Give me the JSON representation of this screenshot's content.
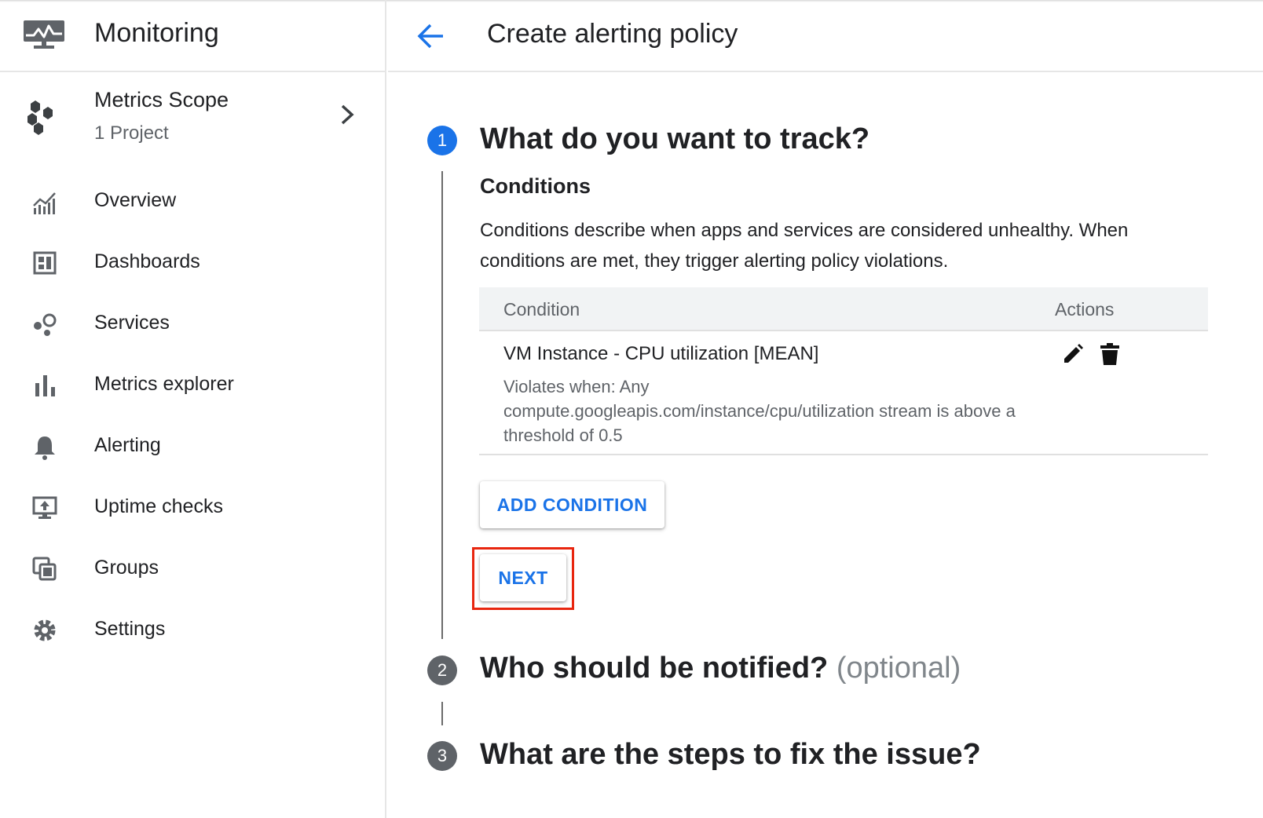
{
  "sidebar": {
    "app_title": "Monitoring",
    "scope": {
      "name": "Metrics Scope",
      "subtitle": "1 Project"
    },
    "items": [
      {
        "label": "Overview",
        "icon": "chart-icon"
      },
      {
        "label": "Dashboards",
        "icon": "dashboard-icon"
      },
      {
        "label": "Services",
        "icon": "services-icon"
      },
      {
        "label": "Metrics explorer",
        "icon": "bar-chart-icon"
      },
      {
        "label": "Alerting",
        "icon": "bell-icon"
      },
      {
        "label": "Uptime checks",
        "icon": "uptime-icon"
      },
      {
        "label": "Groups",
        "icon": "groups-icon"
      },
      {
        "label": "Settings",
        "icon": "gear-icon"
      }
    ]
  },
  "header": {
    "title": "Create alerting policy"
  },
  "steps": [
    {
      "number": "1",
      "title": "What do you want to track?",
      "optional": ""
    },
    {
      "number": "2",
      "title": "Who should be notified?",
      "optional": "(optional)"
    },
    {
      "number": "3",
      "title": "What are the steps to fix the issue?",
      "optional": ""
    }
  ],
  "conditions": {
    "heading": "Conditions",
    "description": "Conditions describe when apps and services are considered unhealthy. When conditions are met, they trigger alerting policy violations.",
    "table": {
      "col_condition": "Condition",
      "col_actions": "Actions",
      "rows": [
        {
          "name": "VM Instance - CPU utilization [MEAN]",
          "detail": "Violates when: Any compute.googleapis.com/instance/cpu/utilization stream is above a threshold of 0.5"
        }
      ]
    },
    "add_button": "ADD CONDITION",
    "next_button": "NEXT"
  },
  "colors": {
    "accent": "#1a73e8",
    "highlight": "#e8260f",
    "step_inactive": "#5f6368"
  }
}
